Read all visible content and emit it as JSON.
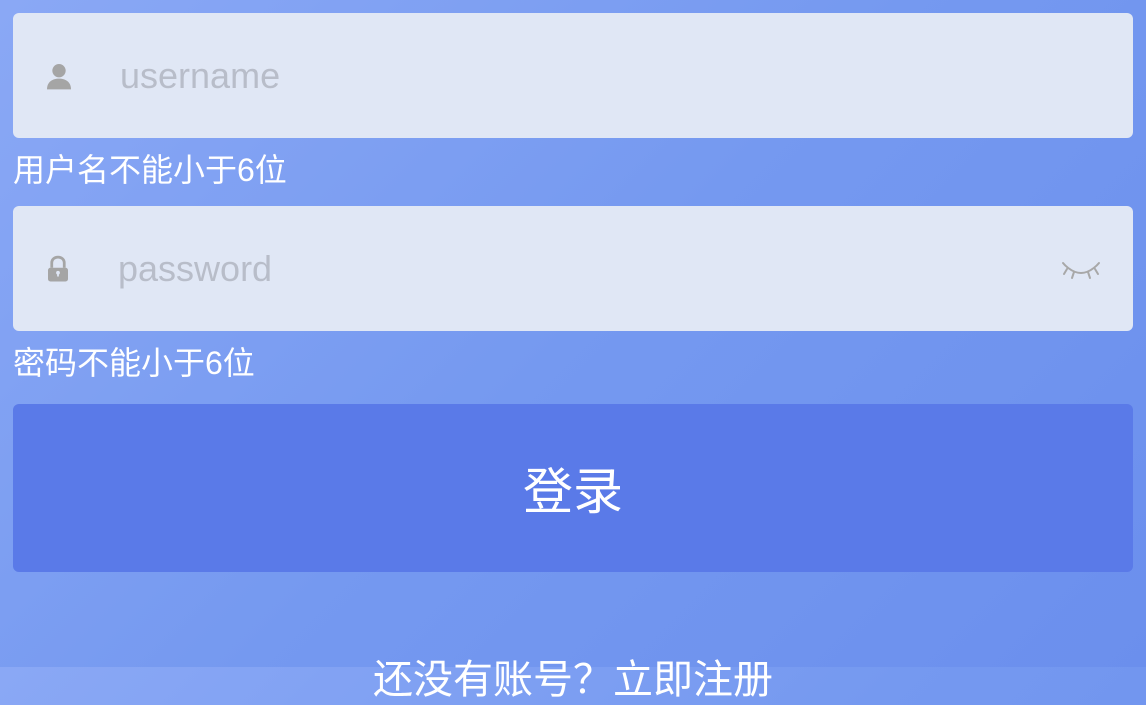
{
  "form": {
    "username": {
      "placeholder": "username",
      "value": "",
      "error": "用户名不能小于6位"
    },
    "password": {
      "placeholder": "password",
      "value": "",
      "error": "密码不能小于6位"
    },
    "submitLabel": "登录"
  },
  "footer": {
    "registerPrompt": "还没有账号？立即注册"
  }
}
